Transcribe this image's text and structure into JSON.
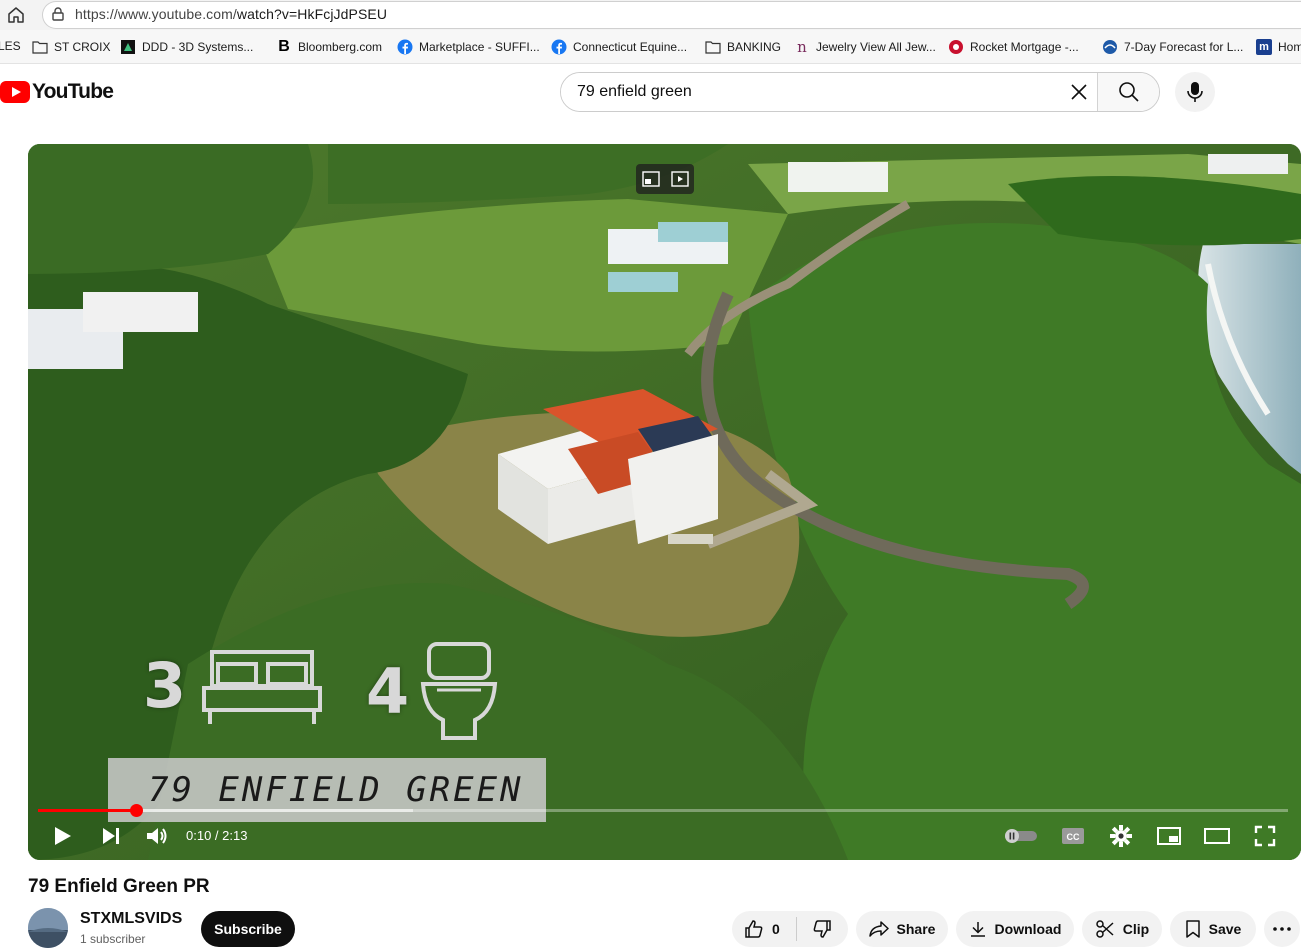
{
  "browser": {
    "url_prefix": "https://www.youtube.com/",
    "url_path": "watch?v=HkFcjJdPSEU",
    "bookmarks": [
      {
        "label": "LES",
        "icon": "none"
      },
      {
        "label": "ST CROIX",
        "icon": "folder-icon"
      },
      {
        "label": "DDD - 3D Systems...",
        "icon": "ddd-logo-icon"
      },
      {
        "label": "Bloomberg.com",
        "icon": "bloomberg-icon"
      },
      {
        "label": "Marketplace - SUFFI...",
        "icon": "facebook-icon"
      },
      {
        "label": "Connecticut Equine...",
        "icon": "facebook-icon"
      },
      {
        "label": "BANKING",
        "icon": "folder-icon"
      },
      {
        "label": "Jewelry View All Jew...",
        "icon": "jewelry-icon"
      },
      {
        "label": "Rocket Mortgage -...",
        "icon": "rocket-icon"
      },
      {
        "label": "7-Day Forecast for L...",
        "icon": "noaa-icon"
      },
      {
        "label": "Hom",
        "icon": "m-icon"
      }
    ]
  },
  "youtube": {
    "logo_text": "YouTube",
    "search_value": "79 enfield green",
    "search_placeholder": "Search"
  },
  "player": {
    "bedrooms": "3",
    "bathrooms": "4",
    "address_overlay": "79 ENFIELD GREEN",
    "current_time": "0:10",
    "duration": "2:13",
    "time_display": "0:10 / 2:13",
    "progress_fraction": 0.078,
    "buffered_fraction": 0.3,
    "accent_color": "#ff0000"
  },
  "video": {
    "title": "79 Enfield Green PR",
    "channel_name": "STXMLSVIDS",
    "subscriber_count": "1 subscriber",
    "subscribe_label": "Subscribe",
    "like_count": "0",
    "share_label": "Share",
    "download_label": "Download",
    "clip_label": "Clip",
    "save_label": "Save"
  }
}
